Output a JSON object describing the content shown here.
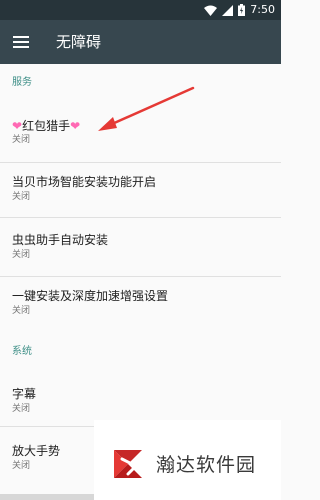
{
  "status_bar": {
    "time": "7:50"
  },
  "toolbar": {
    "title": "无障碍"
  },
  "sections": [
    {
      "header": "服务",
      "items": [
        {
          "title_parts": [
            "❤",
            "红包猎手",
            "❤"
          ],
          "subtitle": "关闭"
        },
        {
          "title": "当贝市场智能安装功能开启",
          "subtitle": "关闭"
        },
        {
          "title": "虫虫助手自动安装",
          "subtitle": "关闭"
        },
        {
          "title": "一键安装及深度加速增强设置",
          "subtitle": "关闭"
        }
      ]
    },
    {
      "header": "系统",
      "items": [
        {
          "title": "字幕",
          "subtitle": "关闭"
        },
        {
          "title": "放大手势",
          "subtitle": "关闭"
        }
      ]
    }
  ],
  "watermark": {
    "text": "瀚达软件园"
  },
  "colors": {
    "accent": "#3e8f87",
    "toolbar": "#37474f",
    "status_bar": "#27343a",
    "arrow": "#e53935",
    "heart": "#ff69b4"
  }
}
